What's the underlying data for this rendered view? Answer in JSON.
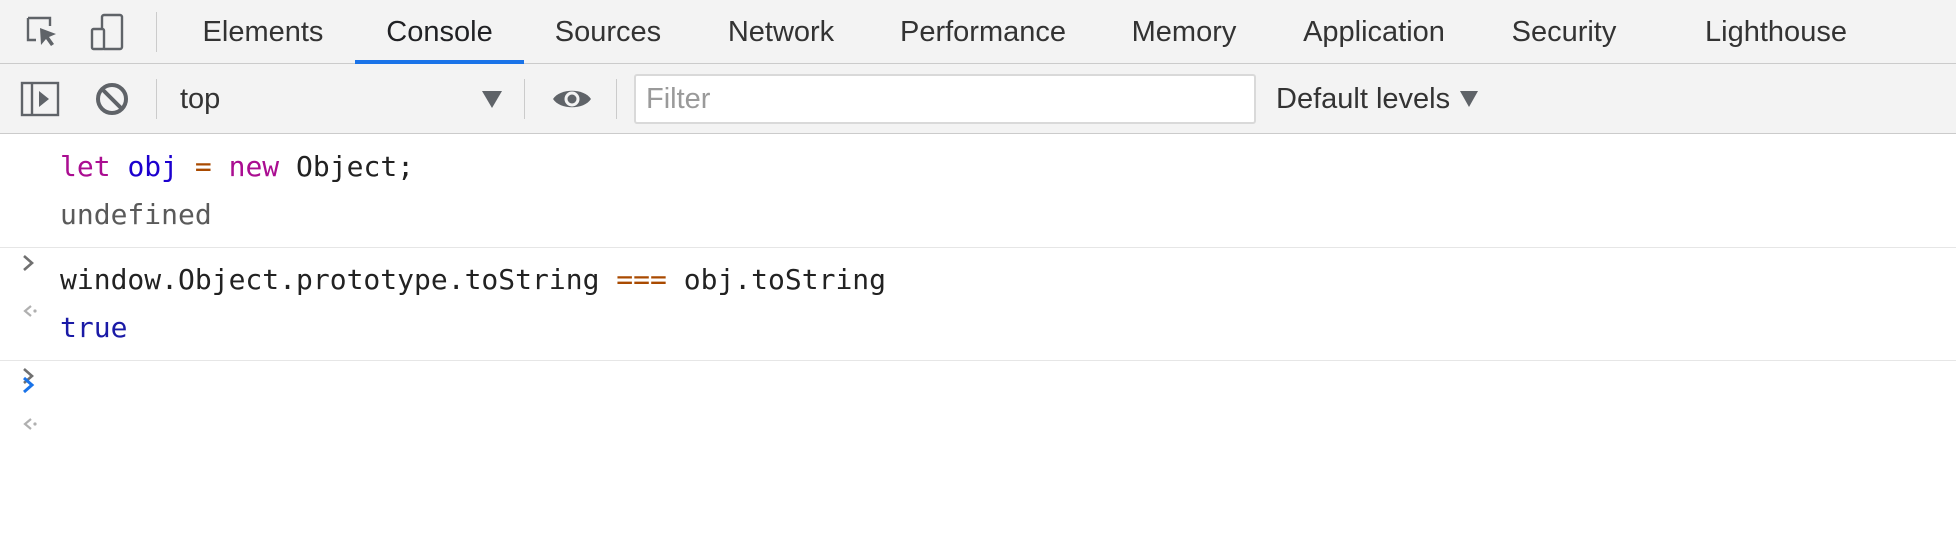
{
  "tabs": [
    {
      "label": "Elements",
      "active": false
    },
    {
      "label": "Console",
      "active": true
    },
    {
      "label": "Sources",
      "active": false
    },
    {
      "label": "Network",
      "active": false
    },
    {
      "label": "Performance",
      "active": false
    },
    {
      "label": "Memory",
      "active": false
    },
    {
      "label": "Application",
      "active": false
    },
    {
      "label": "Security",
      "active": false
    },
    {
      "label": "Lighthouse",
      "active": false
    }
  ],
  "tabbar_icons": [
    "inspect-element-icon",
    "device-toolbar-icon"
  ],
  "toolbar": {
    "sidebar_icon": "show-sidebar-icon",
    "clear_icon": "clear-console-icon",
    "context": "top",
    "live_expression_icon": "eye-icon",
    "filter_placeholder": "Filter",
    "filter_value": "",
    "levels": "Default levels"
  },
  "console": {
    "entries": [
      {
        "input_tokens": [
          {
            "text": "let",
            "type": "kw"
          },
          {
            "text": " ",
            "type": "plain"
          },
          {
            "text": "obj",
            "type": "var"
          },
          {
            "text": " ",
            "type": "plain"
          },
          {
            "text": "=",
            "type": "op"
          },
          {
            "text": " ",
            "type": "plain"
          },
          {
            "text": "new",
            "type": "kw"
          },
          {
            "text": " Object;",
            "type": "plain"
          }
        ],
        "result": "undefined",
        "result_type": "undefined"
      },
      {
        "input_tokens": [
          {
            "text": "window.Object.prototype.toString ",
            "type": "plain"
          },
          {
            "text": "===",
            "type": "op"
          },
          {
            "text": " obj.toString",
            "type": "plain"
          }
        ],
        "result": "true",
        "result_type": "true"
      }
    ],
    "prompt_icon": "prompt-chevron-icon"
  },
  "colors": {
    "accent": "#1a73e8",
    "keyword": "#aa0d91",
    "variable": "#1c00cf",
    "operator": "#a94a00",
    "boolean": "#1a1aa6"
  }
}
